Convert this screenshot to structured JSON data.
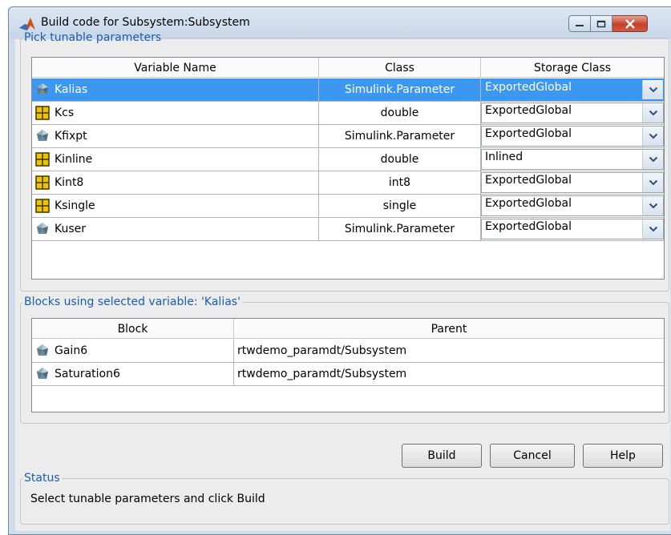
{
  "window": {
    "title": "Build code for Subsystem:Subsystem"
  },
  "params_group": {
    "legend": "Pick tunable parameters",
    "columns": [
      "Variable Name",
      "Class",
      "Storage Class"
    ],
    "rows": [
      {
        "icon": "simulink-parameter-icon",
        "name": "Kalias",
        "class": "Simulink.Parameter",
        "storage": "ExportedGlobal",
        "selected": true
      },
      {
        "icon": "matrix-variable-icon",
        "name": "Kcs",
        "class": "double",
        "storage": "ExportedGlobal",
        "selected": false
      },
      {
        "icon": "simulink-parameter-icon",
        "name": "Kfixpt",
        "class": "Simulink.Parameter",
        "storage": "ExportedGlobal",
        "selected": false
      },
      {
        "icon": "matrix-variable-icon",
        "name": "Kinline",
        "class": "double",
        "storage": "Inlined",
        "selected": false
      },
      {
        "icon": "matrix-variable-icon",
        "name": "Kint8",
        "class": "int8",
        "storage": "ExportedGlobal",
        "selected": false
      },
      {
        "icon": "matrix-variable-icon",
        "name": "Ksingle",
        "class": "single",
        "storage": "ExportedGlobal",
        "selected": false
      },
      {
        "icon": "simulink-parameter-icon",
        "name": "Kuser",
        "class": "Simulink.Parameter",
        "storage": "ExportedGlobal",
        "selected": false
      }
    ]
  },
  "blocks_group": {
    "legend": "Blocks using selected variable: 'Kalias'",
    "columns": [
      "Block",
      "Parent"
    ],
    "rows": [
      {
        "icon": "simulink-block-icon",
        "block": "Gain6",
        "parent": "rtwdemo_paramdt/Subsystem"
      },
      {
        "icon": "simulink-block-icon",
        "block": "Saturation6",
        "parent": "rtwdemo_paramdt/Subsystem"
      }
    ]
  },
  "buttons": {
    "build": "Build",
    "cancel": "Cancel",
    "help": "Help"
  },
  "status": {
    "legend": "Status",
    "text": "Select tunable parameters and click Build"
  },
  "colors": {
    "selection": "#3b97f0",
    "legend": "#1a5db0",
    "matrix_icon": "#f2c100"
  }
}
